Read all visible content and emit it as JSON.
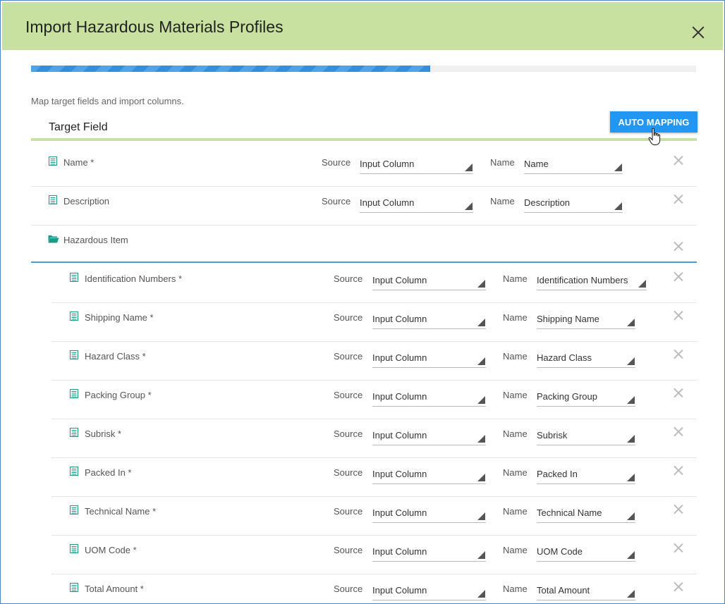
{
  "dialog": {
    "title": "Import Hazardous Materials Profiles",
    "hint": "Map target fields and import columns.",
    "target_field_label": "Target Field",
    "auto_mapping_label": "AUTO MAPPING",
    "progress_fraction": 0.6
  },
  "labels": {
    "source": "Source",
    "name": "Name"
  },
  "top_rows": [
    {
      "label": "Name *",
      "source": "Input Column",
      "name": "Name"
    },
    {
      "label": "Description",
      "source": "Input Column",
      "name": "Description"
    }
  ],
  "group": {
    "label": "Hazardous Item"
  },
  "child_rows": [
    {
      "label": "Identification Numbers *",
      "source": "Input Column",
      "name": "Identification Numbers"
    },
    {
      "label": "Shipping Name *",
      "source": "Input Column",
      "name": "Shipping Name"
    },
    {
      "label": "Hazard Class *",
      "source": "Input Column",
      "name": "Hazard Class"
    },
    {
      "label": "Packing Group *",
      "source": "Input Column",
      "name": "Packing Group"
    },
    {
      "label": "Subrisk *",
      "source": "Input Column",
      "name": "Subrisk"
    },
    {
      "label": "Packed In *",
      "source": "Input Column",
      "name": "Packed In"
    },
    {
      "label": "Technical Name *",
      "source": "Input Column",
      "name": "Technical Name"
    },
    {
      "label": "UOM Code *",
      "source": "Input Column",
      "name": "UOM Code"
    },
    {
      "label": "Total Amount *",
      "source": "Input Column",
      "name": "Total Amount"
    }
  ],
  "colors": {
    "header": "#c8e1a0",
    "accent": "#2196f3",
    "icon": "#1a9a8a"
  }
}
